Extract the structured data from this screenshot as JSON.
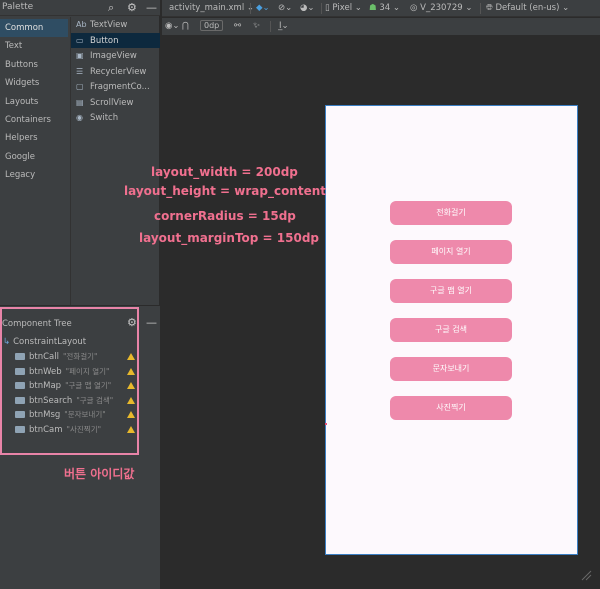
{
  "palette": {
    "title": "Palette",
    "categories": [
      "Common",
      "Text",
      "Buttons",
      "Widgets",
      "Layouts",
      "Containers",
      "Helpers",
      "Google",
      "Legacy"
    ],
    "selected_category": "Common",
    "items": [
      {
        "icon": "Ab",
        "label": "TextView"
      },
      {
        "icon": "▭",
        "label": "Button"
      },
      {
        "icon": "▣",
        "label": "ImageView"
      },
      {
        "icon": "☰",
        "label": "RecyclerView"
      },
      {
        "icon": "▢",
        "label": "FragmentCo..."
      },
      {
        "icon": "▤",
        "label": "ScrollView"
      },
      {
        "icon": "◉",
        "label": "Switch"
      }
    ]
  },
  "toolbar": {
    "file_tab": "activity_main.xml",
    "device": "Pixel",
    "api": "34",
    "theme": "V_230729",
    "locale": "Default (en-us)",
    "margin_value": "0dp"
  },
  "component_tree": {
    "title": "Component Tree",
    "root": "ConstraintLayout",
    "children": [
      {
        "id": "btnCall",
        "text": "\"전화걸기\""
      },
      {
        "id": "btnWeb",
        "text": "\"페이지 열기\""
      },
      {
        "id": "btnMap",
        "text": "\"구글 맵 열기\""
      },
      {
        "id": "btnSearch",
        "text": "\"구글 검색\""
      },
      {
        "id": "btnMsg",
        "text": "\"문자보내기\""
      },
      {
        "id": "btnCam",
        "text": "\"사진찍기\""
      }
    ],
    "caption": "버튼 아이디값"
  },
  "annotations": {
    "line1": "layout_width  =  200dp",
    "line2": "layout_height  =  wrap_content",
    "line3": "cornerRadius  =  15dp",
    "line4": "layout_marginTop = 150dp"
  },
  "device_buttons": [
    "전화걸기",
    "페이지 열기",
    "구글 맵 열기",
    "구글 검색",
    "문자보내기",
    "사진찍기"
  ],
  "colors": {
    "button_bg": "#ee89ab",
    "annotation_pink": "#f0708f",
    "device_border": "#3b7fc4",
    "ide_bg": "#2b2b2b"
  }
}
